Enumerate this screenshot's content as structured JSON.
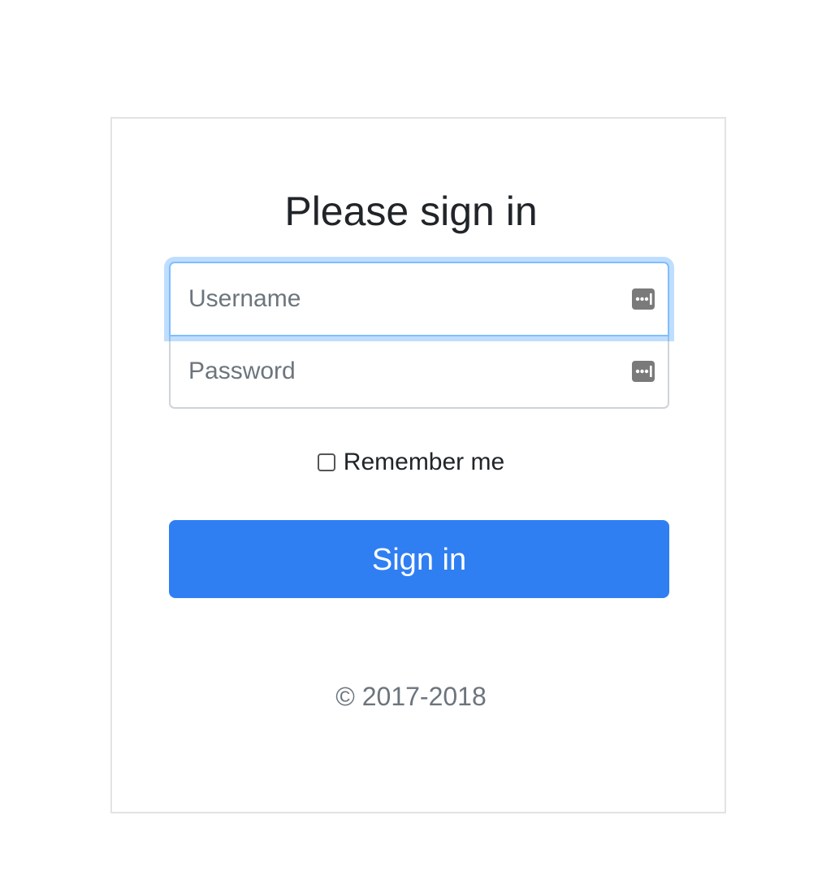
{
  "form": {
    "title": "Please sign in",
    "username": {
      "placeholder": "Username",
      "value": "",
      "icon": "password-manager-icon"
    },
    "password": {
      "placeholder": "Password",
      "value": "",
      "icon": "password-manager-icon"
    },
    "remember_label": "Remember me",
    "remember_checked": false,
    "submit_label": "Sign in",
    "footer": "© 2017-2018"
  },
  "colors": {
    "primary": "#2f7ff3",
    "focus_border": "#80bdff",
    "text": "#212529",
    "muted": "#6c757d"
  }
}
